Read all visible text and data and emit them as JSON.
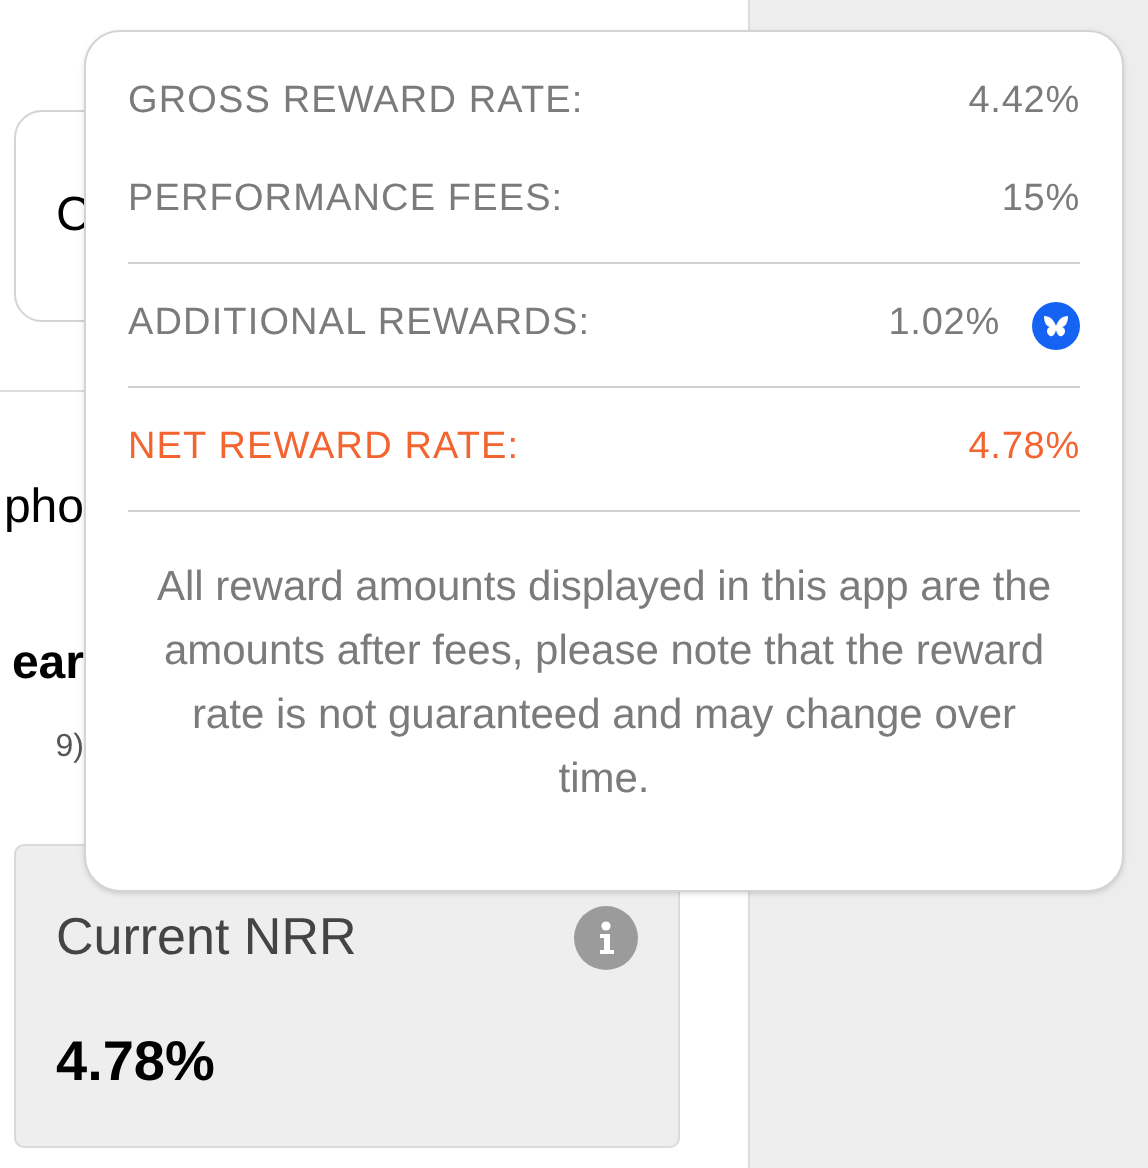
{
  "page": {
    "card_fragment": "C",
    "line_fragment": "pho",
    "heading_fragment": "ear",
    "note_fragment": "9)"
  },
  "tooltip": {
    "rows": [
      {
        "label": "GROSS REWARD RATE:",
        "value": "4.42%",
        "kind": "plain",
        "divider_before": false
      },
      {
        "label": "PERFORMANCE FEES:",
        "value": "15%",
        "kind": "plain",
        "divider_before": false
      },
      {
        "label": "ADDITIONAL REWARDS:",
        "value": "1.02%",
        "kind": "bonus",
        "divider_before": true
      },
      {
        "label": "NET REWARD RATE:",
        "value": "4.78%",
        "kind": "total",
        "divider_before": true
      }
    ],
    "note": "All reward amounts displayed in this app are the amounts after fees, please note that the reward rate is not guaranteed and may change over time."
  },
  "nrr_card": {
    "title": "Current NRR",
    "value": "4.78%"
  }
}
